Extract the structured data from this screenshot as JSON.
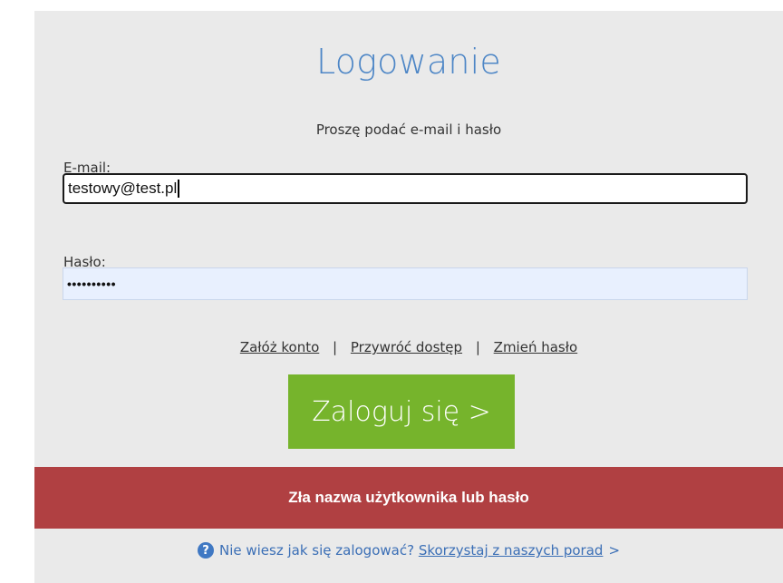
{
  "form": {
    "title": "Logowanie",
    "subtitle": "Proszę podać e-mail i hasło",
    "email_label": "E-mail:",
    "email_value": "testowy@test.pl",
    "password_label": "Hasło:",
    "password_value": "••••••••••"
  },
  "links": {
    "create_account": "Załóż konto",
    "restore_access": "Przywróć dostęp",
    "change_password": "Zmień hasło",
    "separator": "|"
  },
  "login_button_label": "Zaloguj się >",
  "error_message": "Zła nazwa użytkownika lub hasło",
  "help": {
    "icon": "question-circle-icon",
    "text": "Nie wiesz jak się zalogować?",
    "link": "Skorzystaj z naszych porad",
    "arrow": ">"
  },
  "colors": {
    "title": "#4d86c6",
    "button": "#76b42c",
    "error_bg": "#b04042",
    "help_link": "#3b6fb6"
  }
}
